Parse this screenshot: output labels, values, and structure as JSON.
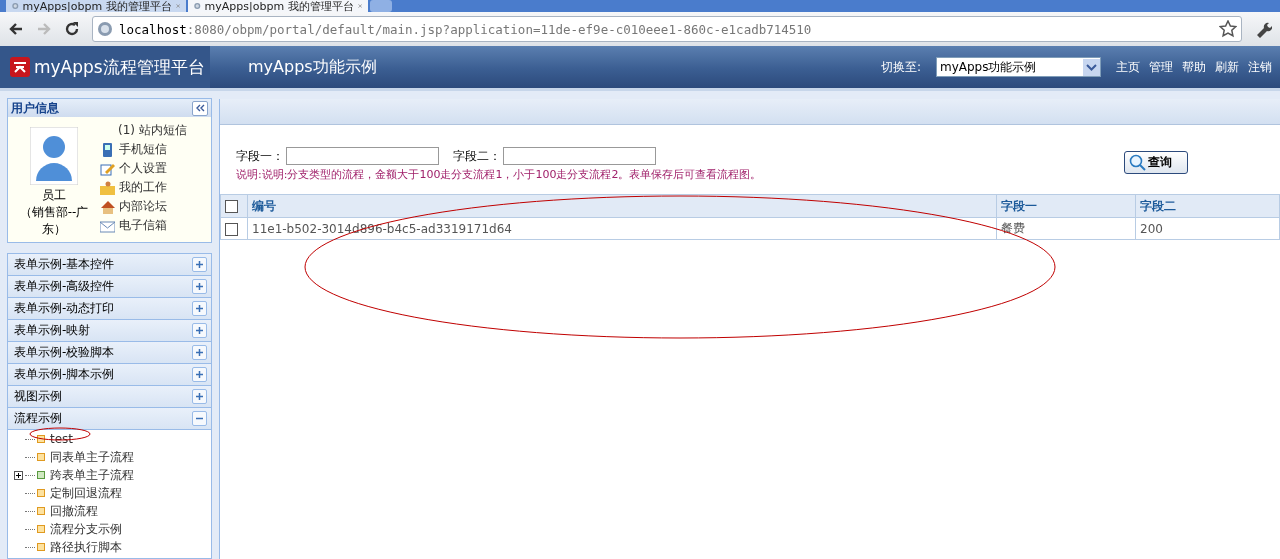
{
  "browser": {
    "tabs": [
      {
        "title": "myApps|obpm 我的管理平台",
        "selected": false
      },
      {
        "title": "myApps|obpm 我的管理平台",
        "selected": true
      }
    ],
    "url_host": "localhost",
    "url_rest": ":8080/obpm/portal/default/main.jsp?application=11de-ef9e-c010eee1-860c-e1cadb714510"
  },
  "header": {
    "logo": "myApps流程管理平台",
    "app_title": "myApps功能示例",
    "switch_label": "切换至:",
    "switch_value": "myApps功能示例",
    "links": [
      "主页",
      "管理",
      "帮助",
      "刷新",
      "注销"
    ]
  },
  "user_panel": {
    "title": "用户信息",
    "name": "员工",
    "dept": "（销售部--广东）",
    "messages": "(1) 站内短信",
    "links": [
      {
        "kind": "phone",
        "label": "手机短信"
      },
      {
        "kind": "edit",
        "label": "个人设置"
      },
      {
        "kind": "folder",
        "label": "我的工作"
      },
      {
        "kind": "home",
        "label": "内部论坛"
      },
      {
        "kind": "mail",
        "label": "电子信箱"
      }
    ]
  },
  "sidebar": {
    "sections": [
      {
        "label": "表单示例-基本控件",
        "expanded": false
      },
      {
        "label": "表单示例-高级控件",
        "expanded": false
      },
      {
        "label": "表单示例-动态打印",
        "expanded": false
      },
      {
        "label": "表单示例-映射",
        "expanded": false
      },
      {
        "label": "表单示例-校验脚本",
        "expanded": false
      },
      {
        "label": "表单示例-脚本示例",
        "expanded": false
      },
      {
        "label": "视图示例",
        "expanded": false
      },
      {
        "label": "流程示例",
        "expanded": true,
        "children": [
          {
            "label": "test",
            "kind": "leaf"
          },
          {
            "label": "同表单主子流程",
            "kind": "leaf"
          },
          {
            "label": "跨表单主子流程",
            "kind": "folder"
          },
          {
            "label": "定制回退流程",
            "kind": "leaf"
          },
          {
            "label": "回撤流程",
            "kind": "leaf"
          },
          {
            "label": "流程分支示例",
            "kind": "leaf"
          },
          {
            "label": "路径执行脚本",
            "kind": "leaf"
          }
        ]
      }
    ]
  },
  "search_form": {
    "fields": [
      {
        "label": "字段一："
      },
      {
        "label": "字段二："
      }
    ],
    "note": "说明:说明:分支类型的流程，金额大于100走分支流程1，小于100走分支流程2。表单保存后可查看流程图。",
    "button": "查询"
  },
  "table": {
    "select_all_checked": false,
    "columns": [
      "编号",
      "字段一",
      "字段二"
    ],
    "rows": [
      {
        "checked": false,
        "cells": [
          "11e1-b502-3014d896-b4c5-ad3319171d64",
          "餐费",
          "200"
        ]
      }
    ]
  }
}
